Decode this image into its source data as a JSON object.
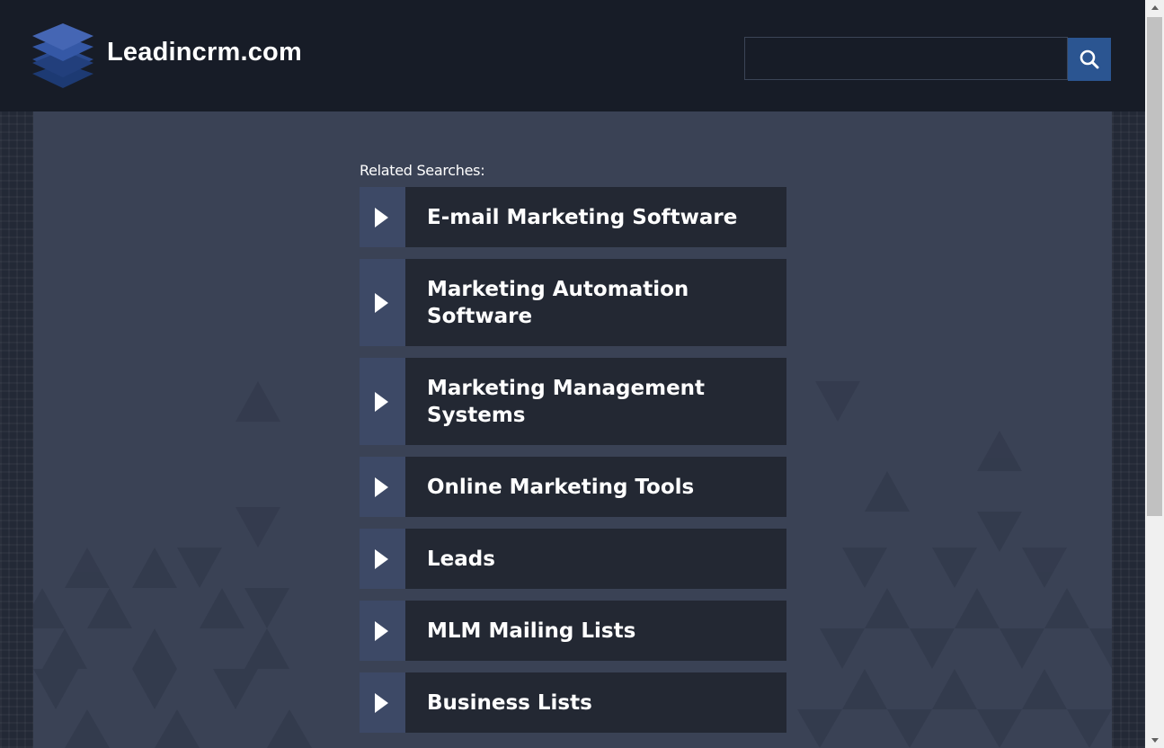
{
  "header": {
    "site_name": "Leadincrm.com",
    "search": {
      "value": "",
      "placeholder": ""
    },
    "search_icon": "search-icon"
  },
  "main": {
    "related_label": "Related Searches:",
    "items": [
      {
        "label": "E-mail Marketing Software"
      },
      {
        "label": "Marketing Automation Software"
      },
      {
        "label": "Marketing Management Systems"
      },
      {
        "label": "Online Marketing Tools"
      },
      {
        "label": "Leads"
      },
      {
        "label": "MLM Mailing Lists"
      },
      {
        "label": "Business Lists"
      }
    ]
  },
  "colors": {
    "header_bg": "#171c27",
    "panel_bg": "#3a4255",
    "item_bg": "#232833",
    "arrow_box_bg": "#3d4966",
    "search_button_bg": "#2b5591"
  }
}
